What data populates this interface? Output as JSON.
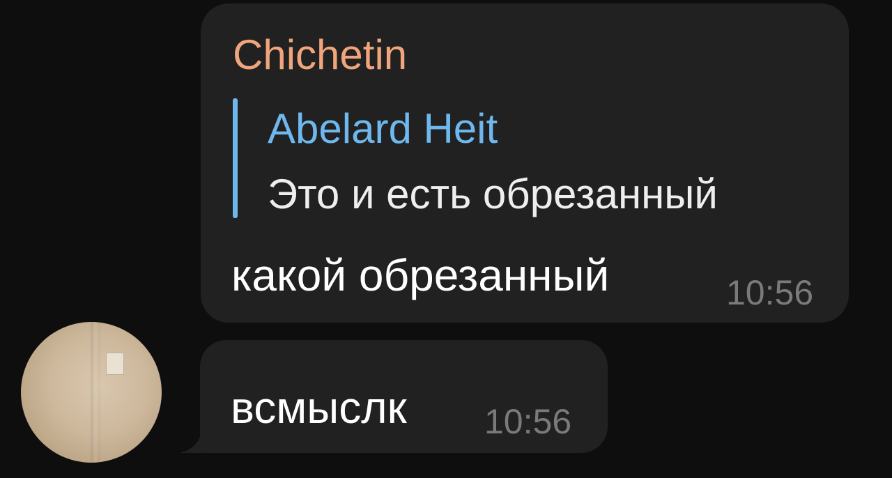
{
  "chat": {
    "message_1": {
      "sender": "Chichetin",
      "reply": {
        "author": "Abelard Heit",
        "text": "Это и есть обрезанный"
      },
      "text": "какой обрезанный",
      "time": "10:56"
    },
    "message_2": {
      "text": "всмыслк",
      "time": "10:56"
    }
  },
  "colors": {
    "background": "#0e0e0e",
    "bubble": "#212121",
    "sender_name": "#f0a57c",
    "reply_accent": "#6fb8ee",
    "message_text": "#ffffff",
    "timestamp": "#7a7a7a"
  },
  "icons": {
    "avatar": "user-avatar-photo"
  }
}
